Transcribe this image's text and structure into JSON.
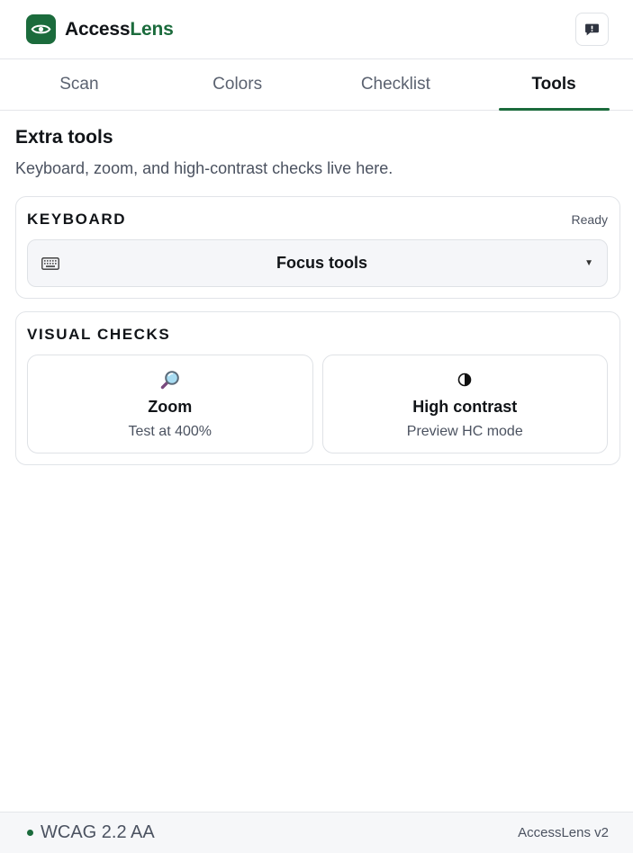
{
  "brand": {
    "name_part1": "Access",
    "name_part2": "Lens",
    "logo_icon": "eye-icon",
    "accent_color": "#1b6b3c"
  },
  "header": {
    "feedback_icon": "feedback-icon"
  },
  "tabs": [
    {
      "label": "Scan",
      "active": false
    },
    {
      "label": "Colors",
      "active": false
    },
    {
      "label": "Checklist",
      "active": false
    },
    {
      "label": "Tools",
      "active": true
    }
  ],
  "section": {
    "title": "Extra tools",
    "description": "Keyboard, zoom, and high-contrast checks live here."
  },
  "keyboard_card": {
    "title": "KEYBOARD",
    "status": "Ready",
    "select_icon": "keyboard-icon",
    "select_value": "Focus tools"
  },
  "visual_card": {
    "title": "VISUAL CHECKS",
    "tiles": [
      {
        "icon": "magnifier-icon",
        "title": "Zoom",
        "subtitle": "Test at 400%"
      },
      {
        "icon": "contrast-icon",
        "title": "High contrast",
        "subtitle": "Preview HC mode"
      }
    ]
  },
  "footer": {
    "standard": "WCAG 2.2 AA",
    "version": "AccessLens v2"
  }
}
